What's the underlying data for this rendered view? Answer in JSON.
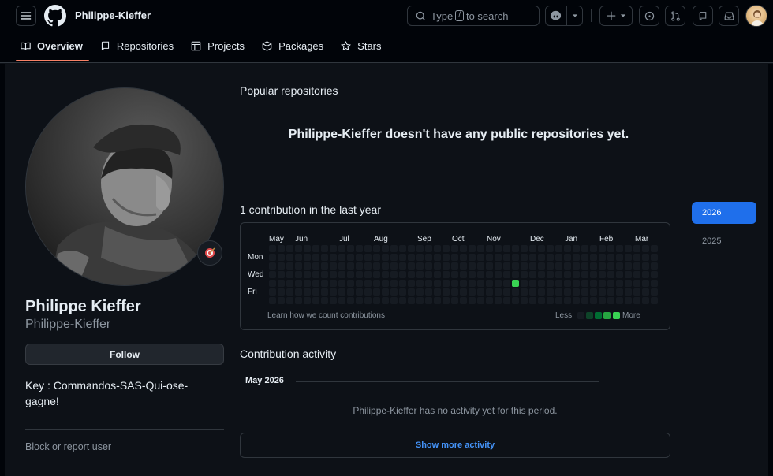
{
  "header": {
    "owner": "Philippe-Kieffer",
    "search_prefix": "Type",
    "search_key": "/",
    "search_suffix": "to search"
  },
  "tabs": [
    {
      "label": "Overview",
      "icon": "book-icon",
      "active": true
    },
    {
      "label": "Repositories",
      "icon": "repo-icon"
    },
    {
      "label": "Projects",
      "icon": "table-icon"
    },
    {
      "label": "Packages",
      "icon": "package-icon"
    },
    {
      "label": "Stars",
      "icon": "star-icon"
    }
  ],
  "profile": {
    "name": "Philippe Kieffer",
    "login": "Philippe-Kieffer",
    "follow_label": "Follow",
    "bio": "Key : Commandos-SAS-Qui-ose-gagne!",
    "block_label": "Block or report user",
    "status_icon": "dart-target-icon"
  },
  "popular": {
    "title": "Popular repositories",
    "empty_message": "Philippe-Kieffer doesn't have any public repositories yet."
  },
  "contributions": {
    "title": "1 contribution in the last year",
    "months": [
      "May",
      "Jun",
      "Jul",
      "Aug",
      "Sep",
      "Oct",
      "Nov",
      "Dec",
      "Jan",
      "Feb",
      "Mar"
    ],
    "days": [
      "Mon",
      "Wed",
      "Fri"
    ],
    "learn_label": "Learn how we count contributions",
    "less_label": "Less",
    "more_label": "More",
    "active_cell": {
      "week": 28,
      "day": 4,
      "count": 1
    },
    "legend_colors": [
      "#161b22",
      "#0e4429",
      "#006d32",
      "#26a641",
      "#39d353"
    ]
  },
  "years": [
    "2026",
    "2025"
  ],
  "active_year": "2026",
  "activity": {
    "title": "Contribution activity",
    "month": "May 2026",
    "empty": "Philippe-Kieffer has no activity yet for this period.",
    "show_more": "Show more activity"
  }
}
